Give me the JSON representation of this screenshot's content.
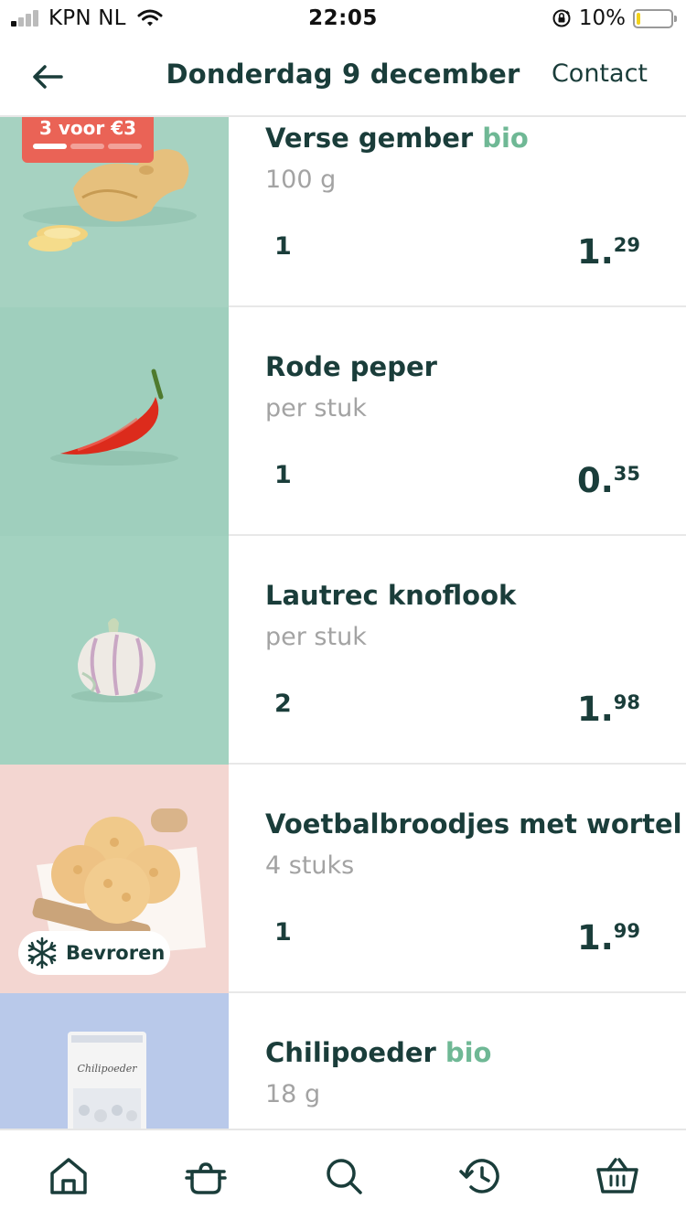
{
  "status_bar": {
    "carrier": "KPN NL",
    "time": "22:05",
    "battery_percent": "10%",
    "battery_level": 0.1,
    "signal_bars_active": 1,
    "icons": [
      "signal-icon",
      "wifi-icon",
      "orientation-lock-icon",
      "battery-icon"
    ]
  },
  "header": {
    "back_icon": "arrow-left-icon",
    "title": "Donderdag 9 december",
    "contact_label": "Contact"
  },
  "colors": {
    "text_primary": "#1a3d3a",
    "text_secondary": "#a3a3a3",
    "bio_green": "#6fb895",
    "promo_red": "#ea6356",
    "image_bg_green": "#9fcfbd",
    "image_bg_pink": "#f5d6d2",
    "image_bg_blue": "#b9c9ea"
  },
  "products": [
    {
      "name": "Verse gember",
      "bio": "bio",
      "unit": "100 g",
      "quantity": "1",
      "price_euros": "1",
      "price_cents": "29",
      "promo": {
        "label": "3 voor €3",
        "progress_filled": 1,
        "progress_total": 3
      }
    },
    {
      "name": "Rode peper",
      "unit": "per stuk",
      "quantity": "1",
      "price_euros": "0",
      "price_cents": "35"
    },
    {
      "name": "Lautrec knoflook",
      "unit": "per stuk",
      "quantity": "2",
      "price_euros": "1",
      "price_cents": "98"
    },
    {
      "name": "Voetbalbroodjes met wortel",
      "unit": "4 stuks",
      "quantity": "1",
      "price_euros": "1",
      "price_cents": "99",
      "frozen_label": "Bevroren"
    },
    {
      "name": "Chilipoeder",
      "bio": "bio",
      "unit": "18 g",
      "package_label": "Chilipoeder"
    }
  ],
  "bottom_nav": [
    {
      "icon": "home-icon"
    },
    {
      "icon": "recipes-pot-icon"
    },
    {
      "icon": "search-icon"
    },
    {
      "icon": "order-history-icon"
    },
    {
      "icon": "basket-icon"
    }
  ]
}
